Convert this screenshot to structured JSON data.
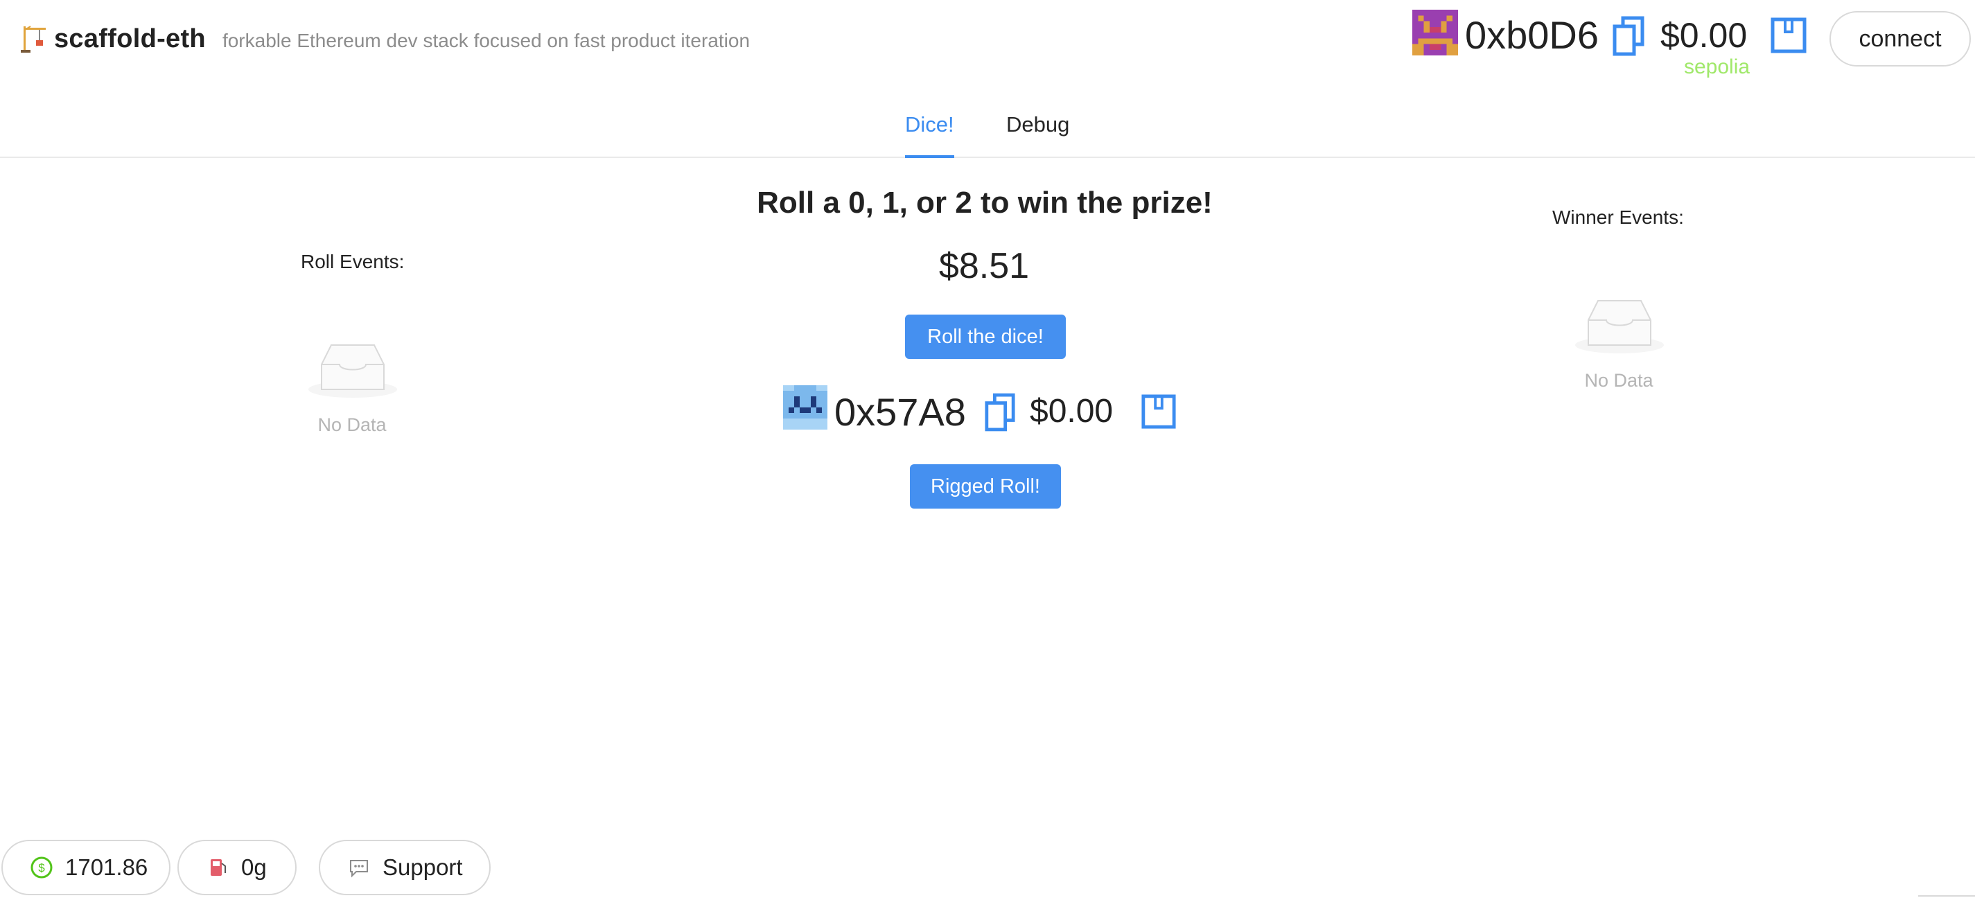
{
  "header": {
    "brand_title": "scaffold-eth",
    "brand_subtitle": "forkable Ethereum dev stack focused on fast product iteration",
    "brand_icon": "construction-crane-icon"
  },
  "account": {
    "address": "0xb0D6",
    "balance": "$0.00",
    "network": "sepolia",
    "network_color": "#a0e86a",
    "connect_label": "connect"
  },
  "tabs": [
    {
      "label": "Dice!",
      "active": true
    },
    {
      "label": "Debug",
      "active": false
    }
  ],
  "main": {
    "headline": "Roll a 0, 1, or 2 to win the prize!",
    "prize": "$8.51",
    "roll_button": "Roll the dice!",
    "contract_address": "0x57A8",
    "contract_balance": "$0.00",
    "rigged_button": "Rigged Roll!"
  },
  "roll_events": {
    "title": "Roll Events:",
    "empty_text": "No Data"
  },
  "winner_events": {
    "title": "Winner Events:",
    "empty_text": "No Data"
  },
  "footer": {
    "eth_price": "1701.86",
    "gas": "0g",
    "support_label": "Support"
  },
  "colors": {
    "accent": "#3b8cf0",
    "button": "#4590f0",
    "muted": "#b5b5b5"
  }
}
